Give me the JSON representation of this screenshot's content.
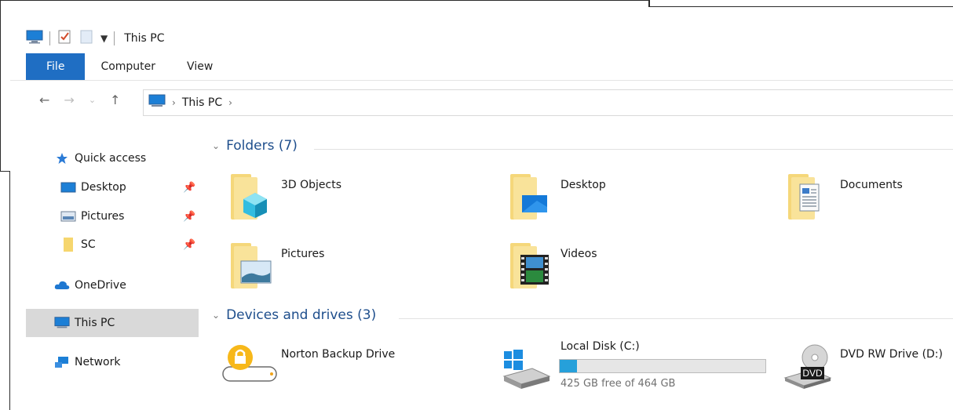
{
  "window": {
    "title": "This PC"
  },
  "ribbon": {
    "tabs": [
      "File",
      "Computer",
      "View"
    ]
  },
  "address": {
    "location": "This PC"
  },
  "sidebar": {
    "items": [
      {
        "label": "Quick access",
        "icon": "star-icon",
        "pinned": false
      },
      {
        "label": "Desktop",
        "icon": "desktop-folder-icon",
        "pinned": true
      },
      {
        "label": "Pictures",
        "icon": "pictures-folder-icon",
        "pinned": true
      },
      {
        "label": "SC",
        "icon": "folder-icon",
        "pinned": true
      },
      {
        "label": "OneDrive",
        "icon": "cloud-icon",
        "pinned": false
      },
      {
        "label": "This PC",
        "icon": "computer-icon",
        "pinned": false,
        "selected": true
      },
      {
        "label": "Network",
        "icon": "network-icon",
        "pinned": false
      }
    ]
  },
  "folders": {
    "header": "Folders (7)",
    "items": [
      {
        "label": "3D Objects",
        "icon": "3d-objects-folder-icon"
      },
      {
        "label": "Desktop",
        "icon": "desktop-folder-icon"
      },
      {
        "label": "Documents",
        "icon": "documents-folder-icon"
      },
      {
        "label": "Pictures",
        "icon": "pictures-folder-icon"
      },
      {
        "label": "Videos",
        "icon": "videos-folder-icon"
      }
    ]
  },
  "devices": {
    "header": "Devices and drives (3)",
    "items": [
      {
        "label": "Norton Backup Drive",
        "icon": "norton-backup-drive-icon"
      },
      {
        "label": "Local Disk (C:)",
        "icon": "windows-disk-icon",
        "free_text": "425 GB free of 464 GB",
        "used_fraction": 0.084
      },
      {
        "label": "DVD RW Drive (D:)",
        "icon": "dvd-drive-icon",
        "badge": "DVD"
      }
    ]
  },
  "colors": {
    "accent": "#1f6ec3",
    "header_text": "#1e4e8c",
    "drive_fill": "#26a0da"
  }
}
